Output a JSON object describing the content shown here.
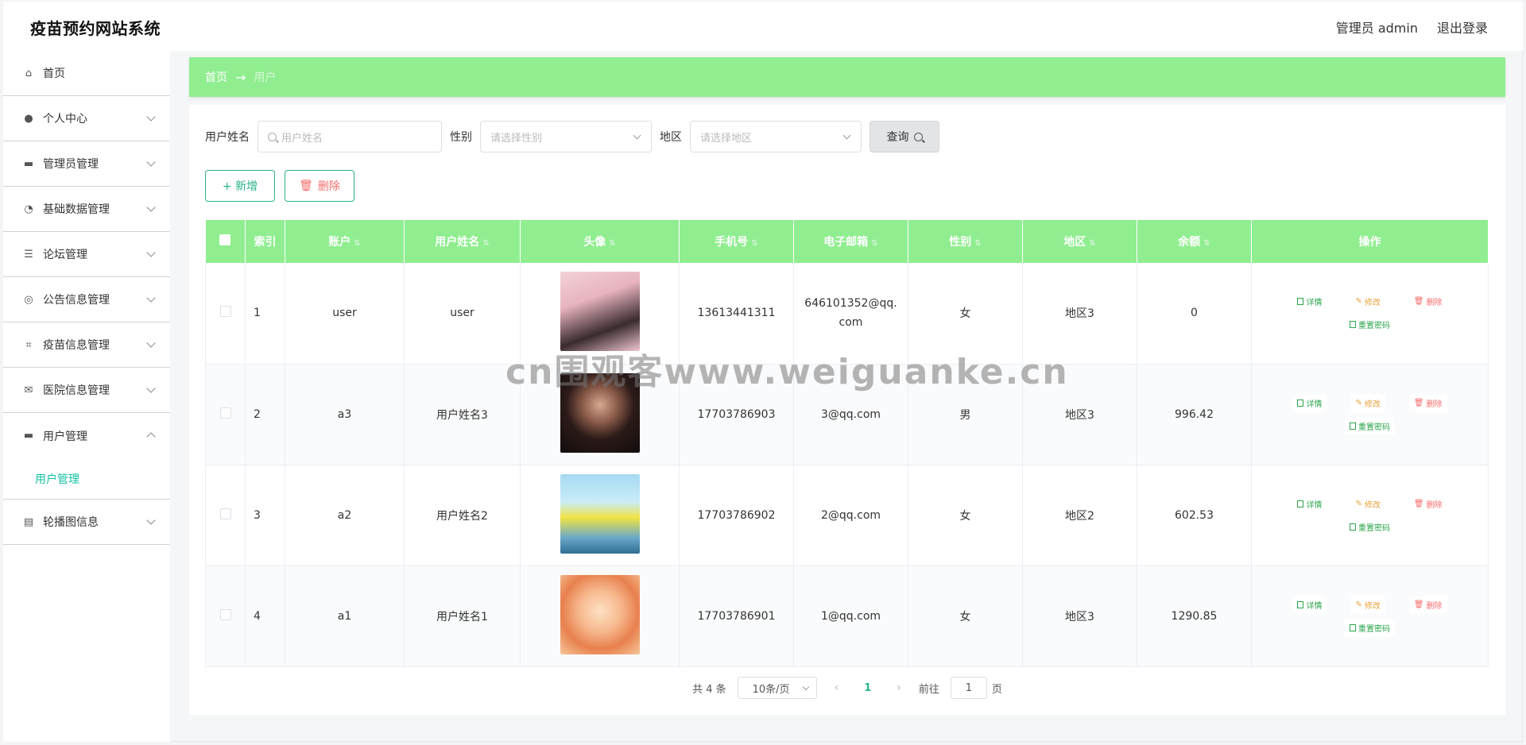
{
  "header": {
    "title": "疫苗预约网站系统",
    "user": "管理员 admin",
    "logout": "退出登录"
  },
  "sidebar": {
    "items": [
      {
        "label": "首页",
        "icon": "home-icon"
      },
      {
        "label": "个人中心",
        "icon": "user-icon"
      },
      {
        "label": "管理员管理",
        "icon": "monitor-icon"
      },
      {
        "label": "基础数据管理",
        "icon": "gauge-icon"
      },
      {
        "label": "论坛管理",
        "icon": "list-icon"
      },
      {
        "label": "公告信息管理",
        "icon": "target-icon"
      },
      {
        "label": "疫苗信息管理",
        "icon": "crop-icon"
      },
      {
        "label": "医院信息管理",
        "icon": "mail-icon"
      },
      {
        "label": "用户管理",
        "icon": "monitor-icon"
      },
      {
        "label": "轮播图信息",
        "icon": "clipboard-icon"
      }
    ],
    "submenu_label": "用户管理"
  },
  "breadcrumb": {
    "home": "首页",
    "arrow": "→",
    "current": "用户"
  },
  "search": {
    "name_label": "用户姓名",
    "name_placeholder": "用户姓名",
    "gender_label": "性别",
    "gender_placeholder": "请选择性别",
    "region_label": "地区",
    "region_placeholder": "请选择地区",
    "query_label": "查询"
  },
  "actions": {
    "add": "+ 新增",
    "delete": "删除"
  },
  "table": {
    "headers": [
      "索引",
      "账户",
      "用户姓名",
      "头像",
      "手机号",
      "电子邮箱",
      "性别",
      "地区",
      "余额",
      "操作"
    ],
    "rows": [
      {
        "index": "1",
        "account": "user",
        "name": "user",
        "phone": "13613441311",
        "email": "646101352@qq.com",
        "gender": "女",
        "region": "地区3",
        "balance": "0"
      },
      {
        "index": "2",
        "account": "a3",
        "name": "用户姓名3",
        "phone": "17703786903",
        "email": "3@qq.com",
        "gender": "男",
        "region": "地区3",
        "balance": "996.42"
      },
      {
        "index": "3",
        "account": "a2",
        "name": "用户姓名2",
        "phone": "17703786902",
        "email": "2@qq.com",
        "gender": "女",
        "region": "地区2",
        "balance": "602.53"
      },
      {
        "index": "4",
        "account": "a1",
        "name": "用户姓名1",
        "phone": "17703786901",
        "email": "1@qq.com",
        "gender": "女",
        "region": "地区3",
        "balance": "1290.85"
      }
    ],
    "ops": {
      "detail": "详情",
      "edit": "修改",
      "remove": "删除",
      "reset": "重置密码"
    }
  },
  "pagination": {
    "total": "共 4 条",
    "page_size": "10条/页",
    "current": "1",
    "goto_prefix": "前往",
    "goto_value": "1",
    "goto_suffix": "页"
  },
  "watermark": "cn围观客www.weiguanke.cn",
  "colors": {
    "accent_green": "#90ee90",
    "primary": "#28b28a",
    "danger": "#f56c6c",
    "warning": "#e6a23c"
  }
}
